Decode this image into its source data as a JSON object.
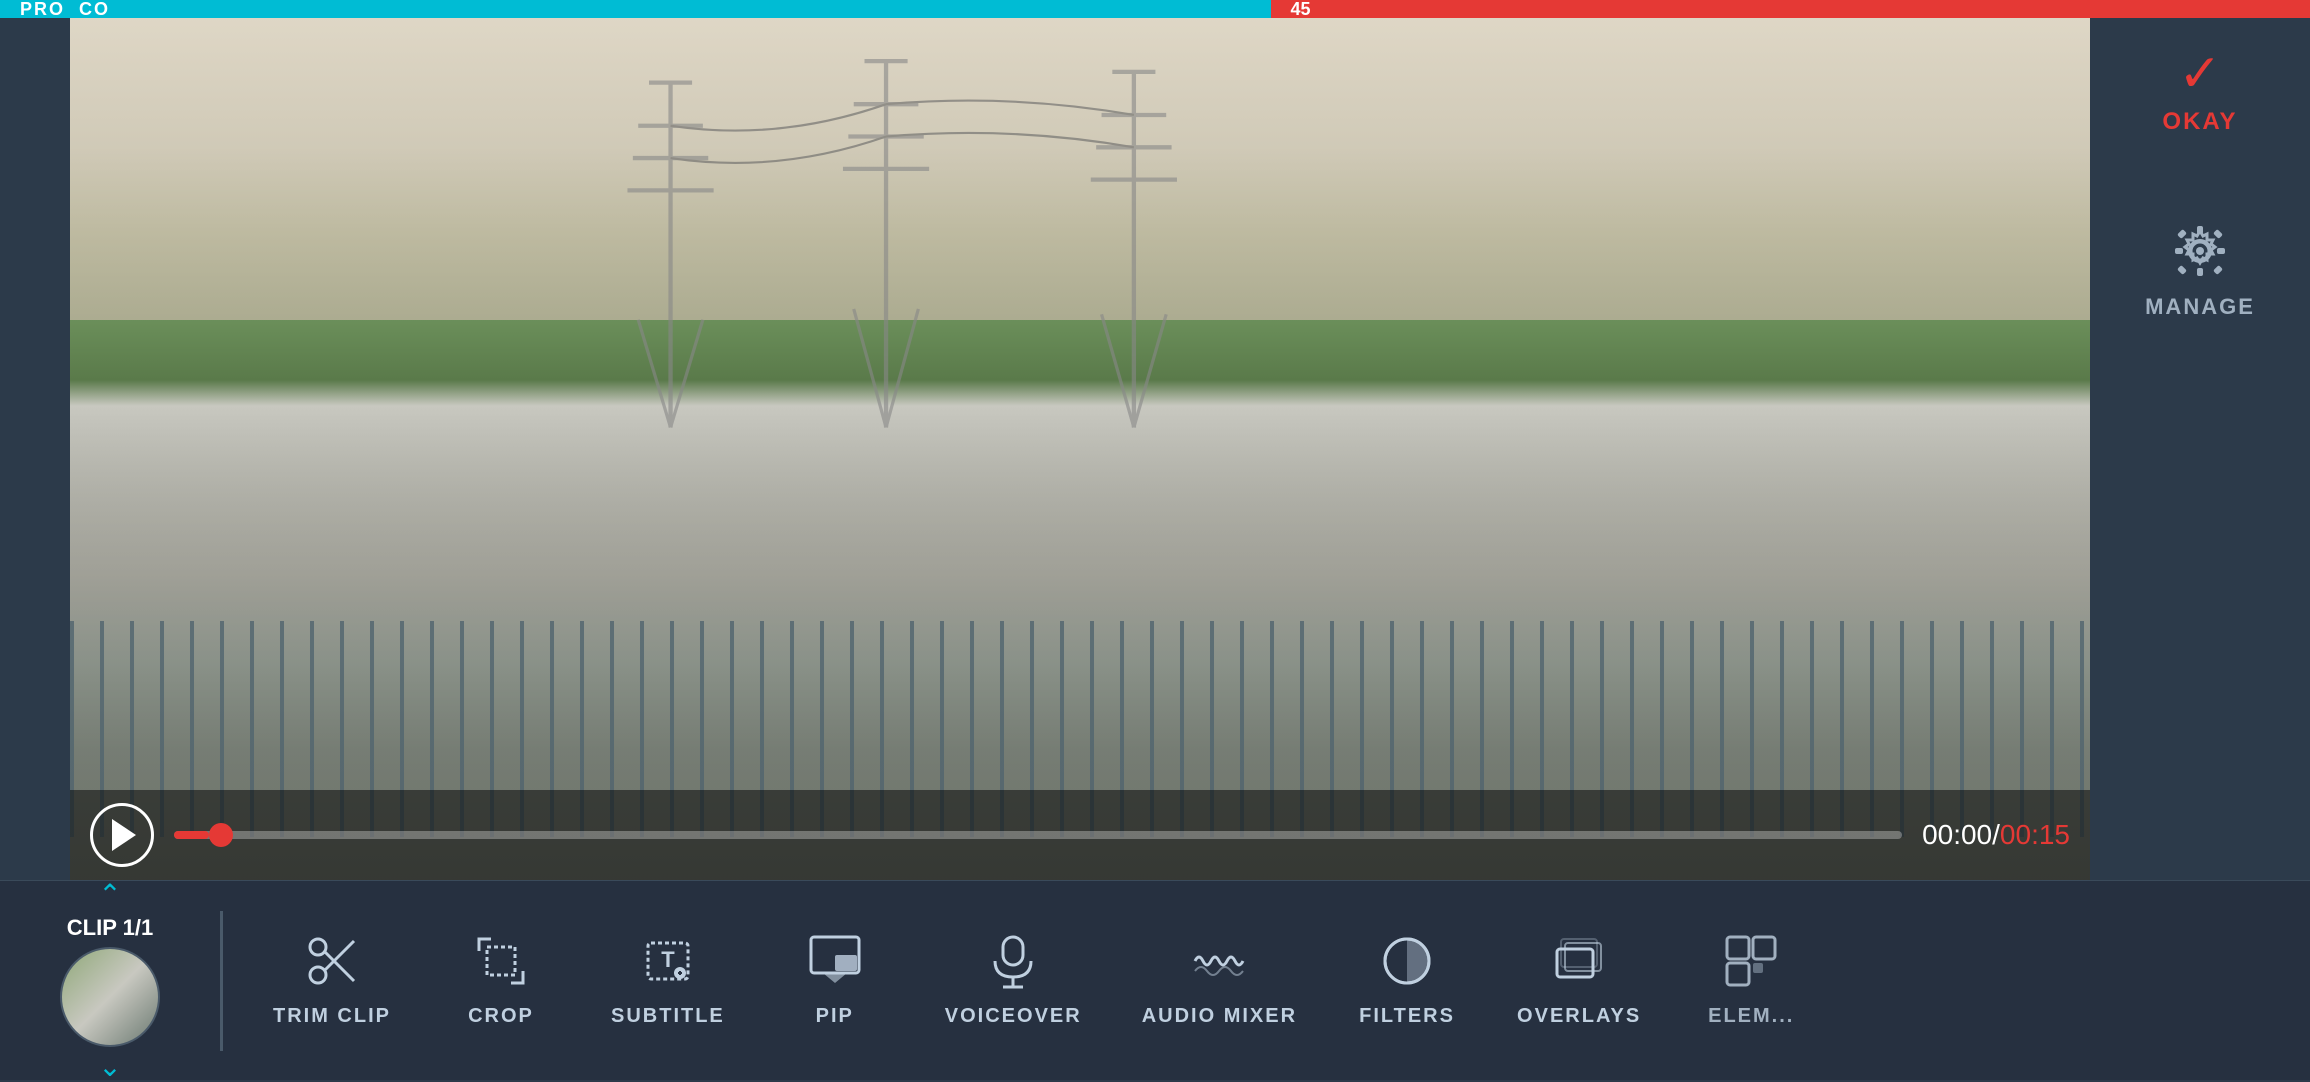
{
  "topBar": {
    "leftLabel": "PRO",
    "leftSuffix": "CO",
    "rightLabel": "45"
  },
  "video": {
    "timeCurrentDisplay": "00:00",
    "timeSeparator": "/",
    "timeTotalDisplay": "00:15",
    "progressPercent": 2
  },
  "rightPanel": {
    "okayLabel": "OKAY",
    "manageLabel": "MANAGE"
  },
  "bottomBar": {
    "clipLabel": "CLIP 1/1",
    "tools": [
      {
        "id": "trim-clip",
        "label": "TRIM CLIP"
      },
      {
        "id": "crop",
        "label": "CROP"
      },
      {
        "id": "subtitle",
        "label": "SUBTITLE"
      },
      {
        "id": "pip",
        "label": "PIP"
      },
      {
        "id": "voiceover",
        "label": "VOICEOVER"
      },
      {
        "id": "audio-mixer",
        "label": "AUDIO MIXER"
      },
      {
        "id": "filters",
        "label": "FILTERS"
      },
      {
        "id": "overlays",
        "label": "OVERLAYS"
      },
      {
        "id": "elements",
        "label": "ELEM..."
      }
    ]
  }
}
